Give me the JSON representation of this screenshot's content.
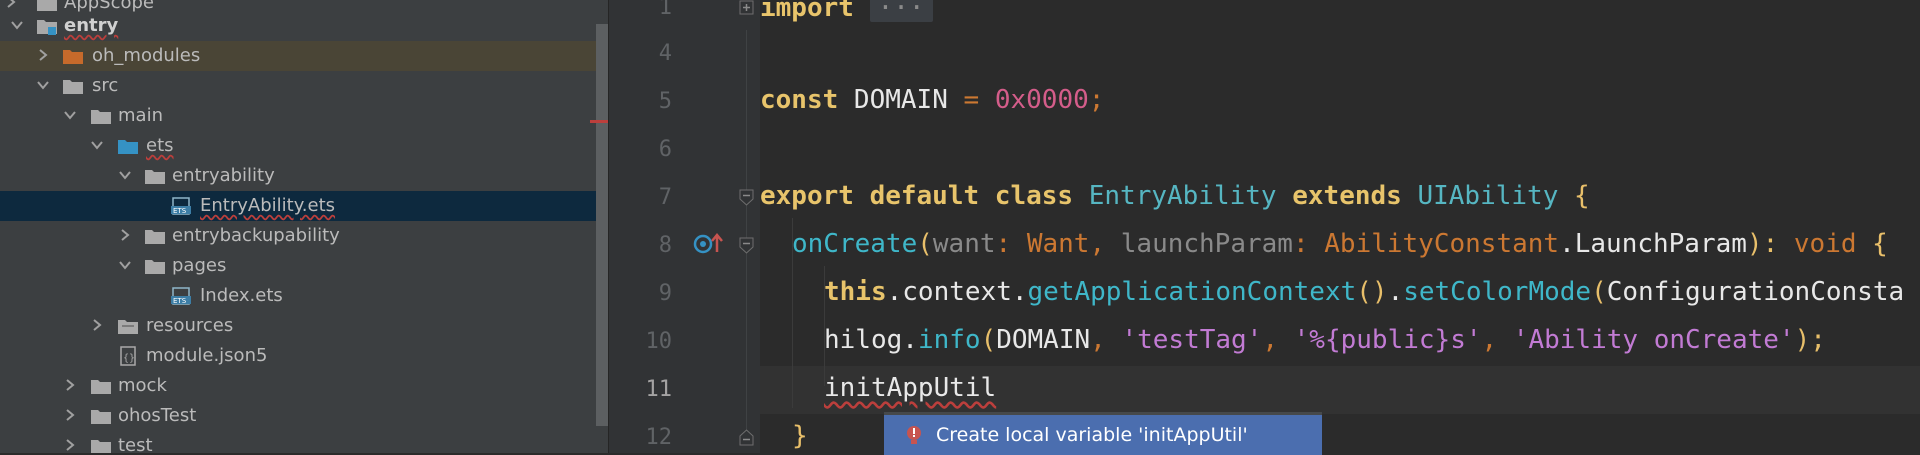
{
  "project_tree": {
    "items": [
      {
        "label": "AppScope",
        "expanded": false
      },
      {
        "label": "entry",
        "expanded": true
      },
      {
        "label": "oh_modules",
        "expanded": false
      },
      {
        "label": "src",
        "expanded": true
      },
      {
        "label": "main",
        "expanded": true
      },
      {
        "label": "ets",
        "expanded": true
      },
      {
        "label": "entryability",
        "expanded": true
      },
      {
        "label": "EntryAbility.ets"
      },
      {
        "label": "entrybackupability",
        "expanded": false
      },
      {
        "label": "pages",
        "expanded": true
      },
      {
        "label": "Index.ets"
      },
      {
        "label": "resources",
        "expanded": false
      },
      {
        "label": "module.json5"
      },
      {
        "label": "mock",
        "expanded": false
      },
      {
        "label": "ohosTest",
        "expanded": false
      },
      {
        "label": "test",
        "expanded": false
      }
    ]
  },
  "editor": {
    "line_numbers": [
      "1",
      "4",
      "5",
      "6",
      "7",
      "8",
      "9",
      "10",
      "11",
      "12"
    ],
    "current_line": "11",
    "lines": {
      "l1": {
        "kw": "import",
        "folded": "···"
      },
      "l5": {
        "kw": "const",
        "name": " DOMAIN ",
        "op": "= ",
        "num": "0x0000",
        "end": ";"
      },
      "l7": {
        "kw1": "export default class ",
        "cls": "EntryAbility",
        "kw2": " extends ",
        "cls2": "UIAbility",
        "brace": " {"
      },
      "l8": {
        "fn": "onCreate",
        "p1": "(",
        "a1": "want",
        "c1": ": ",
        "t1": "Want",
        "cm": ", ",
        "a2": "launchParam",
        "c2": ": ",
        "t2": "AbilityConstant",
        "dot": ".",
        "t3": "LaunchParam",
        "p2": "): ",
        "vd": "void",
        "brace": " {"
      },
      "l9": {
        "kw": "this",
        "d1": ".",
        "ctx": "context",
        "d2": ".",
        "f1": "getApplicationContext",
        "pp": "()",
        "d3": ".",
        "f2": "setColorMode",
        "p": "(",
        "rest": "ConfigurationConsta"
      },
      "l10": {
        "obj": "hilog",
        "d": ".",
        "fn": "info",
        "p": "(",
        "arg": "DOMAIN",
        "c1": ", ",
        "s1": "'testTag'",
        "c2": ", ",
        "s2": "'%{public}s'",
        "c3": ", ",
        "s3": "'Ability onCreate'",
        "end": ");"
      },
      "l11": {
        "ident": "initAppUtil"
      },
      "l12": {
        "brace": "}"
      }
    }
  },
  "popup": {
    "text": "Create local variable 'initAppUtil'",
    "icon": "error-bulb-icon"
  },
  "colors": {
    "tree_bg": "#3c3f41",
    "editor_bg": "#2b2b2b",
    "selection": "#0d293e",
    "popup_bg": "#4b6eaf",
    "error": "#bc3f3c"
  }
}
